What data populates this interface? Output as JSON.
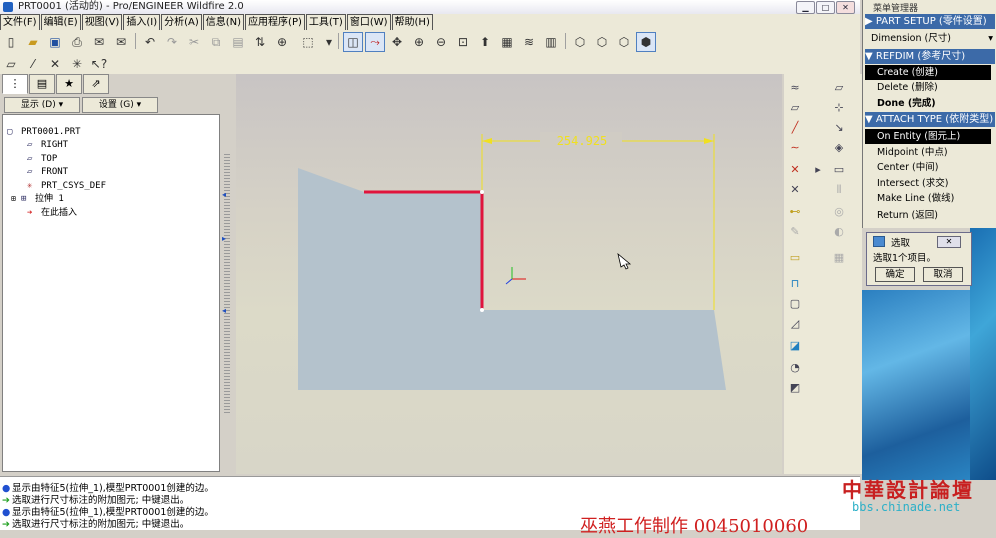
{
  "window": {
    "title": "PRT0001 (活动的) - Pro/ENGINEER Wildfire 2.0",
    "btn_min": "▁",
    "btn_max": "□",
    "btn_close": "✕"
  },
  "menubar": [
    "文件(F)",
    "编辑(E)",
    "视图(V)",
    "插入(I)",
    "分析(A)",
    "信息(N)",
    "应用程序(P)",
    "工具(T)",
    "窗口(W)",
    "帮助(H)"
  ],
  "model_tree": {
    "show_label": "显示 (D) ▾",
    "settings_label": "设置 (G) ▾",
    "nodes": [
      {
        "icon": "part-icon",
        "glyph": "▢",
        "label": "PRT0001.PRT"
      },
      {
        "icon": "datum-plane-icon",
        "glyph": "▱",
        "label": "RIGHT"
      },
      {
        "icon": "datum-plane-icon",
        "glyph": "▱",
        "label": "TOP"
      },
      {
        "icon": "datum-plane-icon",
        "glyph": "▱",
        "label": "FRONT"
      },
      {
        "icon": "csys-icon",
        "glyph": "✳",
        "label": "PRT_CSYS_DEF"
      },
      {
        "icon": "extrude-icon",
        "glyph": "⊞",
        "label": "拉伸 1"
      },
      {
        "icon": "insert-here-arrow-icon",
        "glyph": "➔",
        "label": "在此插入"
      }
    ]
  },
  "graphics": {
    "dimension_value": "254.925"
  },
  "messages": [
    {
      "icon": "info-bullet",
      "text": "显示由特征5(拉伸_1),模型PRT0001创建的边。"
    },
    {
      "icon": "prompt-arrow",
      "text": "选取进行尺寸标注的附加图元; 中键退出。"
    },
    {
      "icon": "info-bullet",
      "text": "显示由特征5(拉伸_1),模型PRT0001创建的边。"
    },
    {
      "icon": "prompt-arrow",
      "text": "选取进行尺寸标注的附加图元; 中键退出。"
    }
  ],
  "menu_manager": {
    "title": "菜单管理器",
    "part_setup": "▶ PART SETUP (零件设置)",
    "dimension_dropdown": "Dimension (尺寸)",
    "refdim": "▼ REFDIM (参考尺寸)",
    "refdim_items": [
      {
        "label": "Create (创建)",
        "state": "selected"
      },
      {
        "label": "Delete (删除)",
        "state": "normal"
      },
      {
        "label": "Done (完成)",
        "state": "bold"
      }
    ],
    "attach_type": "▼ ATTACH TYPE (依附类型)",
    "attach_items": [
      {
        "label": "On Entity (图元上)",
        "state": "selected"
      },
      {
        "label": "Midpoint (中点)",
        "state": "normal"
      },
      {
        "label": "Center (中间)",
        "state": "normal"
      },
      {
        "label": "Intersect (求交)",
        "state": "normal"
      },
      {
        "label": "Make Line (做线)",
        "state": "normal"
      },
      {
        "label": "Return (返回)",
        "state": "normal"
      }
    ]
  },
  "select_dialog": {
    "title": "选取",
    "message": "选取1个项目。",
    "ok": "确定",
    "cancel": "取消"
  },
  "watermark": {
    "forum": "中華設計論壇",
    "url": "bbs.chinade.net",
    "author": "巫燕工作制作 0045010060"
  },
  "colors": {
    "sketch_red": "#e0143c",
    "dimension_yellow": "#f0e020",
    "part_fill": "#b4c2cc",
    "menu_header": "#3c6aa8"
  }
}
